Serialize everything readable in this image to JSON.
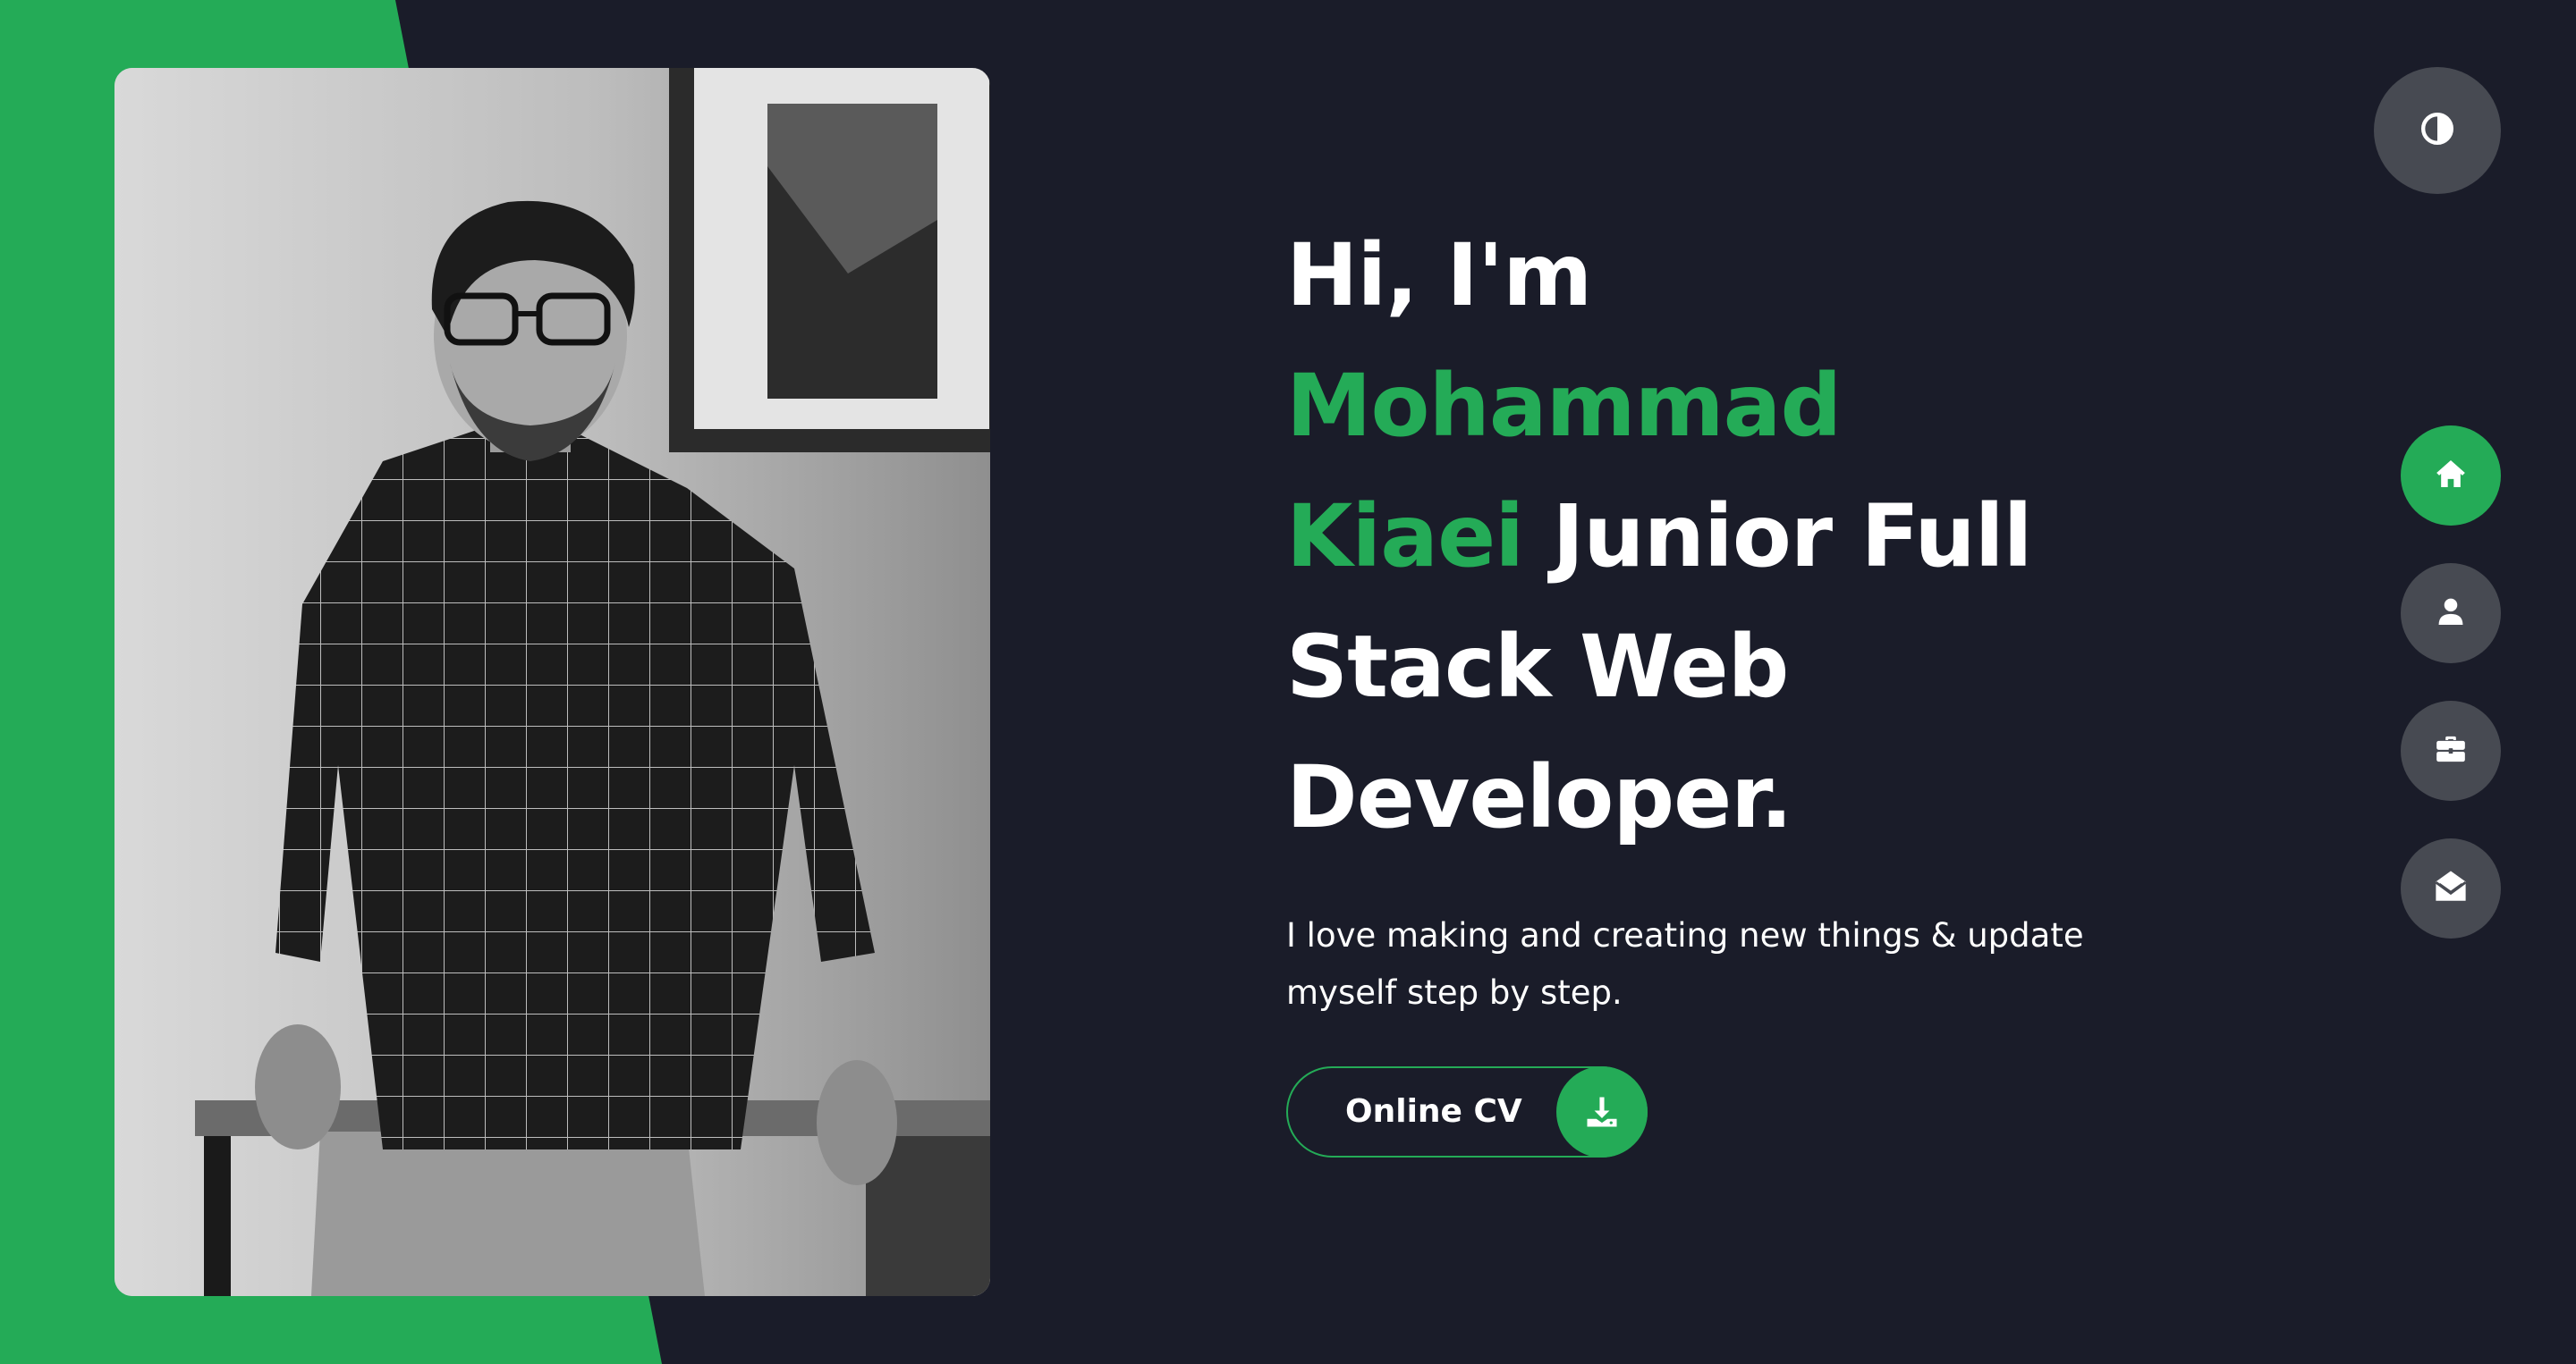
{
  "hero": {
    "line1": "Hi, I'm",
    "name_first": "Mohammad",
    "name_last": "Kiaei",
    "role_part1": "Junior Full",
    "role_part2": "Stack Web",
    "role_part3": "Developer.",
    "tagline": "I love making and creating new things & update myself step by step.",
    "cv_label": "Online CV"
  },
  "icons": {
    "theme_toggle": "contrast-icon",
    "cv": "download-icon",
    "nav_home": "home-icon",
    "nav_about": "user-icon",
    "nav_portfolio": "briefcase-icon",
    "nav_contact": "envelope-open-icon"
  },
  "nav": {
    "active": "home"
  },
  "colors": {
    "accent": "#24ab57",
    "background": "#1a1c29",
    "nav_button": "#474a52",
    "text": "#ffffff"
  }
}
